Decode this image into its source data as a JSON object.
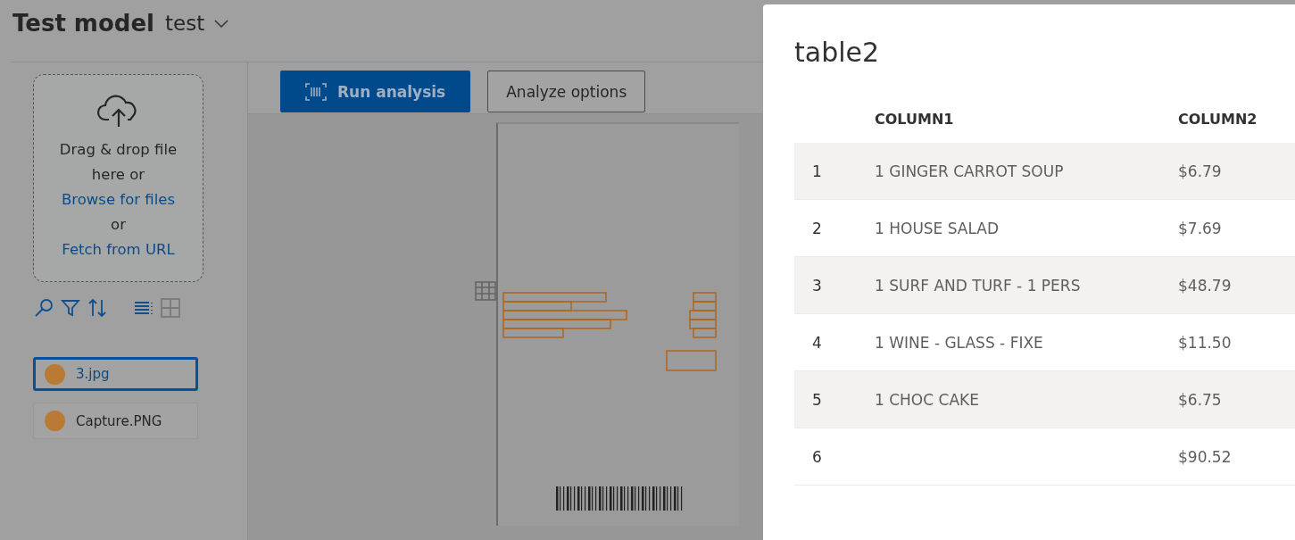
{
  "header": {
    "title": "Test model",
    "model_selector": "test"
  },
  "toolbar": {
    "buttons": [
      {
        "label": "Run analysis",
        "kind": "primary"
      },
      {
        "label": "Analyze options",
        "kind": "secondary"
      }
    ]
  },
  "upload": {
    "lines": [
      "Drag & drop file",
      "here or"
    ],
    "browse_link": "Browse for files",
    "or": "or",
    "fetch_link": "Fetch from URL"
  },
  "view_toggle": [
    {
      "kind": "list",
      "selected": true
    },
    {
      "kind": "grid",
      "selected": false
    }
  ],
  "files": [
    {
      "name": "3.jpg",
      "color": "#b87a35",
      "selected": true
    },
    {
      "name": "Capture.PNG",
      "color": "#b87a35",
      "selected": false
    }
  ],
  "panel": {
    "title": "table2",
    "columns": [
      "COLUMN1",
      "COLUMN2"
    ],
    "rows": [
      {
        "index": "1",
        "cells": [
          "1 GINGER CARROT SOUP",
          "$6.79"
        ]
      },
      {
        "index": "2",
        "cells": [
          "1 HOUSE SALAD",
          "$7.69"
        ]
      },
      {
        "index": "3",
        "cells": [
          "1 SURF AND TURF - 1 PERS",
          "$48.79"
        ]
      },
      {
        "index": "4",
        "cells": [
          "1 WINE - GLASS - FIXE",
          "$11.50"
        ]
      },
      {
        "index": "5",
        "cells": [
          "1 CHOC CAKE",
          "$6.75"
        ]
      },
      {
        "index": "6",
        "cells": [
          "",
          "$90.52"
        ]
      }
    ]
  }
}
